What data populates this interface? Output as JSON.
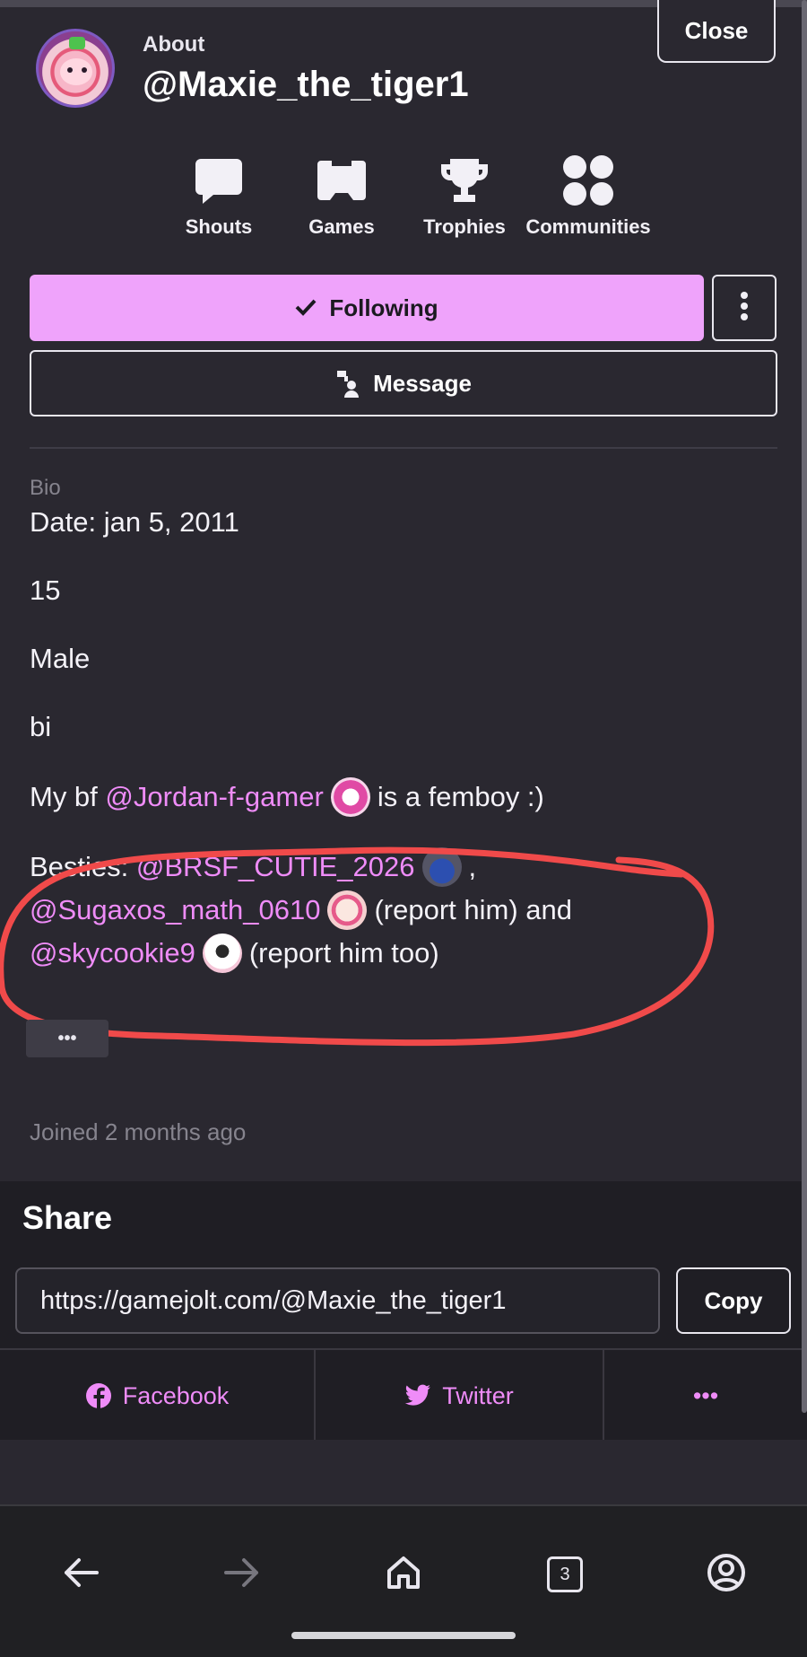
{
  "header": {
    "about_label": "About",
    "username": "@Maxie_the_tiger1",
    "close_label": "Close"
  },
  "stats": [
    {
      "label": "Shouts",
      "icon": "speech-bubble-icon"
    },
    {
      "label": "Games",
      "icon": "gamepad-icon"
    },
    {
      "label": "Trophies",
      "icon": "trophy-icon"
    },
    {
      "label": "Communities",
      "icon": "grid-circles-icon"
    }
  ],
  "actions": {
    "following_label": "Following",
    "message_label": "Message"
  },
  "bio": {
    "label": "Bio",
    "date_line": "Date: jan 5, 2011",
    "age_line": "15",
    "gender_line": "Male",
    "orientation_line": "bi",
    "bf_prefix": "My bf",
    "bf_mention": "@Jordan-f-gamer",
    "bf_suffix": "is a femboy :)",
    "besties_prefix": "Besties:",
    "bestie1": "@BRSF_CUTIE_2026",
    "bestie1_suffix": ",",
    "bestie2": "@Sugaxos_math_0610",
    "bestie2_suffix": "(report him) and",
    "bestie3": "@skycookie9",
    "bestie3_suffix": "(report him too)",
    "expand_label": "•••"
  },
  "joined": "Joined 2 months ago",
  "share": {
    "title": "Share",
    "url": "https://gamejolt.com/@Maxie_the_tiger1",
    "copy_label": "Copy",
    "facebook_label": "Facebook",
    "twitter_label": "Twitter",
    "more_label": "•••"
  },
  "navbar": {
    "tab_count": "3"
  },
  "colors": {
    "background": "#2a2830",
    "accent": "#efa3fb",
    "mention": "#ef8cf8",
    "annotation": "#f04a4a"
  }
}
